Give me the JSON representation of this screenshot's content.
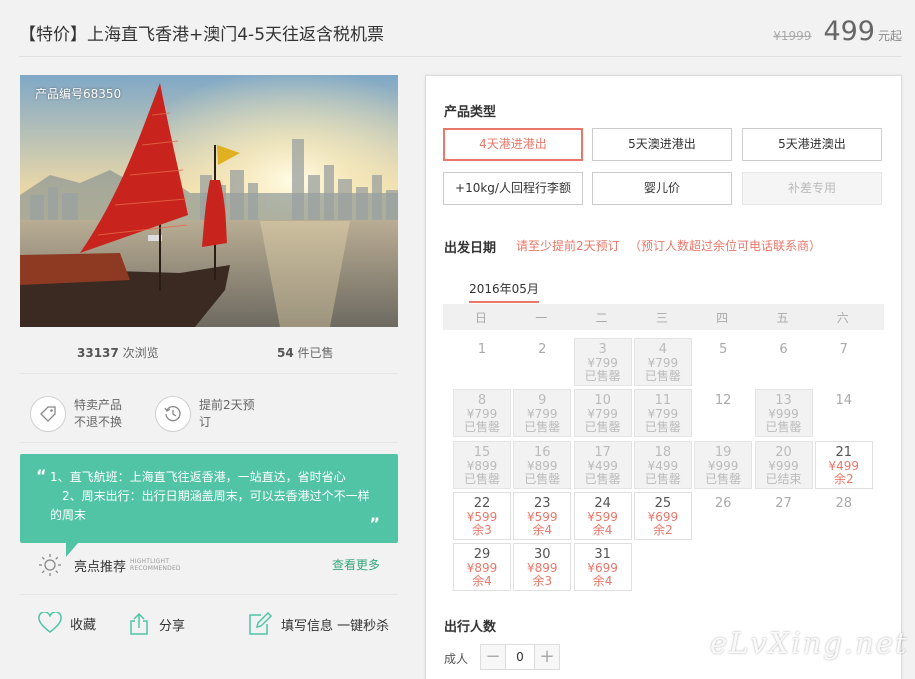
{
  "header": {
    "title": "【特价】上海直飞香港+澳门4-5天往返含税机票",
    "old_price": "¥1999",
    "price": "499",
    "price_unit": "元起"
  },
  "photo": {
    "product_code": "产品编号68350"
  },
  "stats": {
    "views_count": "33137",
    "views_label": "次浏览",
    "sold_count": "54",
    "sold_label": "件已售"
  },
  "features": [
    {
      "line1": "特卖产品",
      "line2": "不退不换",
      "icon": "tag-icon"
    },
    {
      "line1": "提前2天预",
      "line2": "订",
      "icon": "clock-icon"
    }
  ],
  "tips": {
    "lines": [
      "1、直飞航班：上海直飞往返香港，一站直达，省时省心",
      "2、周末出行：出行日期涵盖周末，可以去香港过个不一样",
      "的周末"
    ],
    "open_quote": "“",
    "close_quote": "”"
  },
  "recommend": {
    "label": "亮点推荐",
    "en_line1": "HIGHTLIGHT",
    "en_line2": "RECOMMENDED",
    "see_more": "查看更多"
  },
  "actions": {
    "favorite": "收藏",
    "share": "分享",
    "fill_info": "填写信息 一键秒杀"
  },
  "product_type": {
    "title": "产品类型",
    "options": [
      {
        "label": "4天港进港出",
        "state": "active"
      },
      {
        "label": "5天澳进港出",
        "state": "normal"
      },
      {
        "label": "5天港进澳出",
        "state": "normal"
      },
      {
        "label": "+10kg/人回程行李额",
        "state": "normal"
      },
      {
        "label": "婴儿价",
        "state": "normal"
      },
      {
        "label": "补差专用",
        "state": "disabled"
      }
    ]
  },
  "departure": {
    "title": "出发日期",
    "hint1": "请至少提前2天预订",
    "hint2": "（预订人数超过余位可电话联系商）",
    "month": "2016年05月",
    "weekdays": [
      "日",
      "一",
      "二",
      "三",
      "四",
      "五",
      "六"
    ],
    "days": [
      {
        "d": "1",
        "state": "plain"
      },
      {
        "d": "2",
        "state": "plain"
      },
      {
        "d": "3",
        "p": "¥799",
        "s": "已售罄",
        "state": "sold"
      },
      {
        "d": "4",
        "p": "¥799",
        "s": "已售罄",
        "state": "sold"
      },
      {
        "d": "5",
        "state": "plain"
      },
      {
        "d": "6",
        "state": "plain"
      },
      {
        "d": "7",
        "state": "plain"
      },
      {
        "d": "8",
        "p": "¥799",
        "s": "已售罄",
        "state": "sold"
      },
      {
        "d": "9",
        "p": "¥799",
        "s": "已售罄",
        "state": "sold"
      },
      {
        "d": "10",
        "p": "¥799",
        "s": "已售罄",
        "state": "sold"
      },
      {
        "d": "11",
        "p": "¥799",
        "s": "已售罄",
        "state": "sold"
      },
      {
        "d": "12",
        "state": "plain"
      },
      {
        "d": "13",
        "p": "¥999",
        "s": "已售罄",
        "state": "sold"
      },
      {
        "d": "14",
        "state": "plain"
      },
      {
        "d": "15",
        "p": "¥899",
        "s": "已售罄",
        "state": "sold"
      },
      {
        "d": "16",
        "p": "¥899",
        "s": "已售罄",
        "state": "sold"
      },
      {
        "d": "17",
        "p": "¥499",
        "s": "已售罄",
        "state": "sold"
      },
      {
        "d": "18",
        "p": "¥499",
        "s": "已售罄",
        "state": "sold"
      },
      {
        "d": "19",
        "p": "¥999",
        "s": "已售罄",
        "state": "sold"
      },
      {
        "d": "20",
        "p": "¥999",
        "s": "已结束",
        "state": "sold"
      },
      {
        "d": "21",
        "p": "¥499",
        "s": "余2",
        "state": "avail"
      },
      {
        "d": "22",
        "p": "¥599",
        "s": "余3",
        "state": "avail"
      },
      {
        "d": "23",
        "p": "¥599",
        "s": "余4",
        "state": "avail"
      },
      {
        "d": "24",
        "p": "¥599",
        "s": "余4",
        "state": "avail"
      },
      {
        "d": "25",
        "p": "¥699",
        "s": "余2",
        "state": "avail"
      },
      {
        "d": "26",
        "state": "plain"
      },
      {
        "d": "27",
        "state": "plain"
      },
      {
        "d": "28",
        "state": "plain"
      },
      {
        "d": "29",
        "p": "¥899",
        "s": "余4",
        "state": "avail"
      },
      {
        "d": "30",
        "p": "¥899",
        "s": "余3",
        "state": "avail"
      },
      {
        "d": "31",
        "p": "¥699",
        "s": "余4",
        "state": "avail"
      }
    ]
  },
  "travelers": {
    "title": "出行人数",
    "adult_label": "成人",
    "adult_count": "0",
    "minus": "−",
    "plus": "+"
  },
  "watermark": "eLvXing.net",
  "colors": {
    "accent": "#e9786a",
    "teal": "#51c4a6",
    "link_green": "#37a77f"
  }
}
